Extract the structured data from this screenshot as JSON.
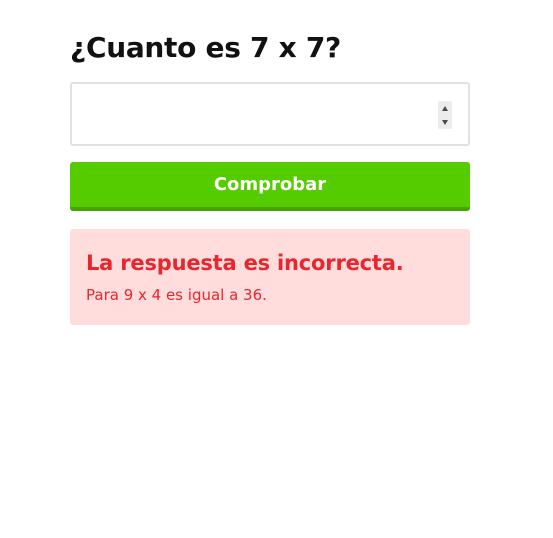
{
  "question": {
    "text": "¿Cuanto es 7 x 7?"
  },
  "answer_input": {
    "value": "",
    "placeholder": ""
  },
  "check_button": {
    "label": "Comprobar"
  },
  "feedback": {
    "title": "La respuesta es incorrecta.",
    "message": "Para 9 x 4 es igual a 36."
  },
  "colors": {
    "button_green": "#54cc00",
    "button_green_shadow": "#44a300",
    "error_text": "#e8262d",
    "error_background": "#ffdddd",
    "input_border": "#e1e1e1"
  }
}
